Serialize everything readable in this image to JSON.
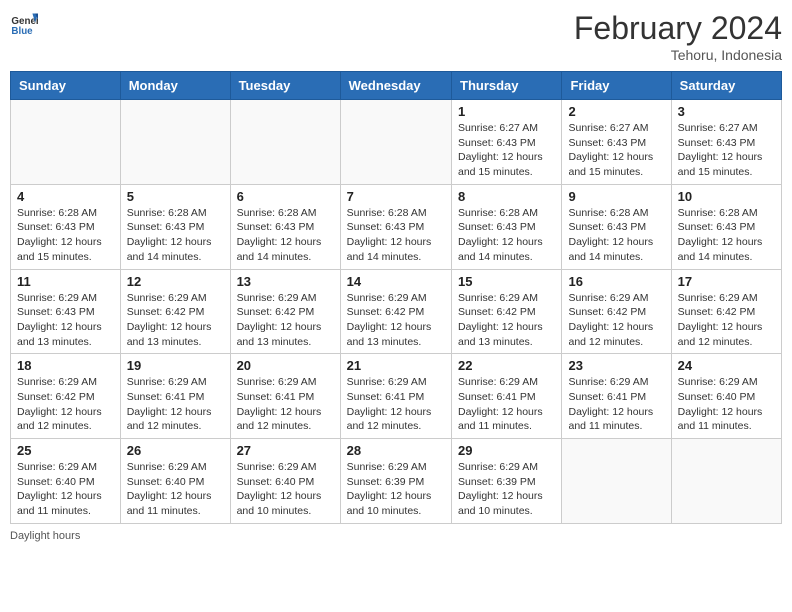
{
  "header": {
    "logo_general": "General",
    "logo_blue": "Blue",
    "main_title": "February 2024",
    "subtitle": "Tehoru, Indonesia"
  },
  "days_of_week": [
    "Sunday",
    "Monday",
    "Tuesday",
    "Wednesday",
    "Thursday",
    "Friday",
    "Saturday"
  ],
  "footer": {
    "daylight_hours_label": "Daylight hours"
  },
  "weeks": [
    [
      {
        "day": "",
        "info": ""
      },
      {
        "day": "",
        "info": ""
      },
      {
        "day": "",
        "info": ""
      },
      {
        "day": "",
        "info": ""
      },
      {
        "day": "1",
        "info": "Sunrise: 6:27 AM\nSunset: 6:43 PM\nDaylight: 12 hours\nand 15 minutes."
      },
      {
        "day": "2",
        "info": "Sunrise: 6:27 AM\nSunset: 6:43 PM\nDaylight: 12 hours\nand 15 minutes."
      },
      {
        "day": "3",
        "info": "Sunrise: 6:27 AM\nSunset: 6:43 PM\nDaylight: 12 hours\nand 15 minutes."
      }
    ],
    [
      {
        "day": "4",
        "info": "Sunrise: 6:28 AM\nSunset: 6:43 PM\nDaylight: 12 hours\nand 15 minutes."
      },
      {
        "day": "5",
        "info": "Sunrise: 6:28 AM\nSunset: 6:43 PM\nDaylight: 12 hours\nand 14 minutes."
      },
      {
        "day": "6",
        "info": "Sunrise: 6:28 AM\nSunset: 6:43 PM\nDaylight: 12 hours\nand 14 minutes."
      },
      {
        "day": "7",
        "info": "Sunrise: 6:28 AM\nSunset: 6:43 PM\nDaylight: 12 hours\nand 14 minutes."
      },
      {
        "day": "8",
        "info": "Sunrise: 6:28 AM\nSunset: 6:43 PM\nDaylight: 12 hours\nand 14 minutes."
      },
      {
        "day": "9",
        "info": "Sunrise: 6:28 AM\nSunset: 6:43 PM\nDaylight: 12 hours\nand 14 minutes."
      },
      {
        "day": "10",
        "info": "Sunrise: 6:28 AM\nSunset: 6:43 PM\nDaylight: 12 hours\nand 14 minutes."
      }
    ],
    [
      {
        "day": "11",
        "info": "Sunrise: 6:29 AM\nSunset: 6:43 PM\nDaylight: 12 hours\nand 13 minutes."
      },
      {
        "day": "12",
        "info": "Sunrise: 6:29 AM\nSunset: 6:42 PM\nDaylight: 12 hours\nand 13 minutes."
      },
      {
        "day": "13",
        "info": "Sunrise: 6:29 AM\nSunset: 6:42 PM\nDaylight: 12 hours\nand 13 minutes."
      },
      {
        "day": "14",
        "info": "Sunrise: 6:29 AM\nSunset: 6:42 PM\nDaylight: 12 hours\nand 13 minutes."
      },
      {
        "day": "15",
        "info": "Sunrise: 6:29 AM\nSunset: 6:42 PM\nDaylight: 12 hours\nand 13 minutes."
      },
      {
        "day": "16",
        "info": "Sunrise: 6:29 AM\nSunset: 6:42 PM\nDaylight: 12 hours\nand 12 minutes."
      },
      {
        "day": "17",
        "info": "Sunrise: 6:29 AM\nSunset: 6:42 PM\nDaylight: 12 hours\nand 12 minutes."
      }
    ],
    [
      {
        "day": "18",
        "info": "Sunrise: 6:29 AM\nSunset: 6:42 PM\nDaylight: 12 hours\nand 12 minutes."
      },
      {
        "day": "19",
        "info": "Sunrise: 6:29 AM\nSunset: 6:41 PM\nDaylight: 12 hours\nand 12 minutes."
      },
      {
        "day": "20",
        "info": "Sunrise: 6:29 AM\nSunset: 6:41 PM\nDaylight: 12 hours\nand 12 minutes."
      },
      {
        "day": "21",
        "info": "Sunrise: 6:29 AM\nSunset: 6:41 PM\nDaylight: 12 hours\nand 12 minutes."
      },
      {
        "day": "22",
        "info": "Sunrise: 6:29 AM\nSunset: 6:41 PM\nDaylight: 12 hours\nand 11 minutes."
      },
      {
        "day": "23",
        "info": "Sunrise: 6:29 AM\nSunset: 6:41 PM\nDaylight: 12 hours\nand 11 minutes."
      },
      {
        "day": "24",
        "info": "Sunrise: 6:29 AM\nSunset: 6:40 PM\nDaylight: 12 hours\nand 11 minutes."
      }
    ],
    [
      {
        "day": "25",
        "info": "Sunrise: 6:29 AM\nSunset: 6:40 PM\nDaylight: 12 hours\nand 11 minutes."
      },
      {
        "day": "26",
        "info": "Sunrise: 6:29 AM\nSunset: 6:40 PM\nDaylight: 12 hours\nand 11 minutes."
      },
      {
        "day": "27",
        "info": "Sunrise: 6:29 AM\nSunset: 6:40 PM\nDaylight: 12 hours\nand 10 minutes."
      },
      {
        "day": "28",
        "info": "Sunrise: 6:29 AM\nSunset: 6:39 PM\nDaylight: 12 hours\nand 10 minutes."
      },
      {
        "day": "29",
        "info": "Sunrise: 6:29 AM\nSunset: 6:39 PM\nDaylight: 12 hours\nand 10 minutes."
      },
      {
        "day": "",
        "info": ""
      },
      {
        "day": "",
        "info": ""
      }
    ]
  ]
}
